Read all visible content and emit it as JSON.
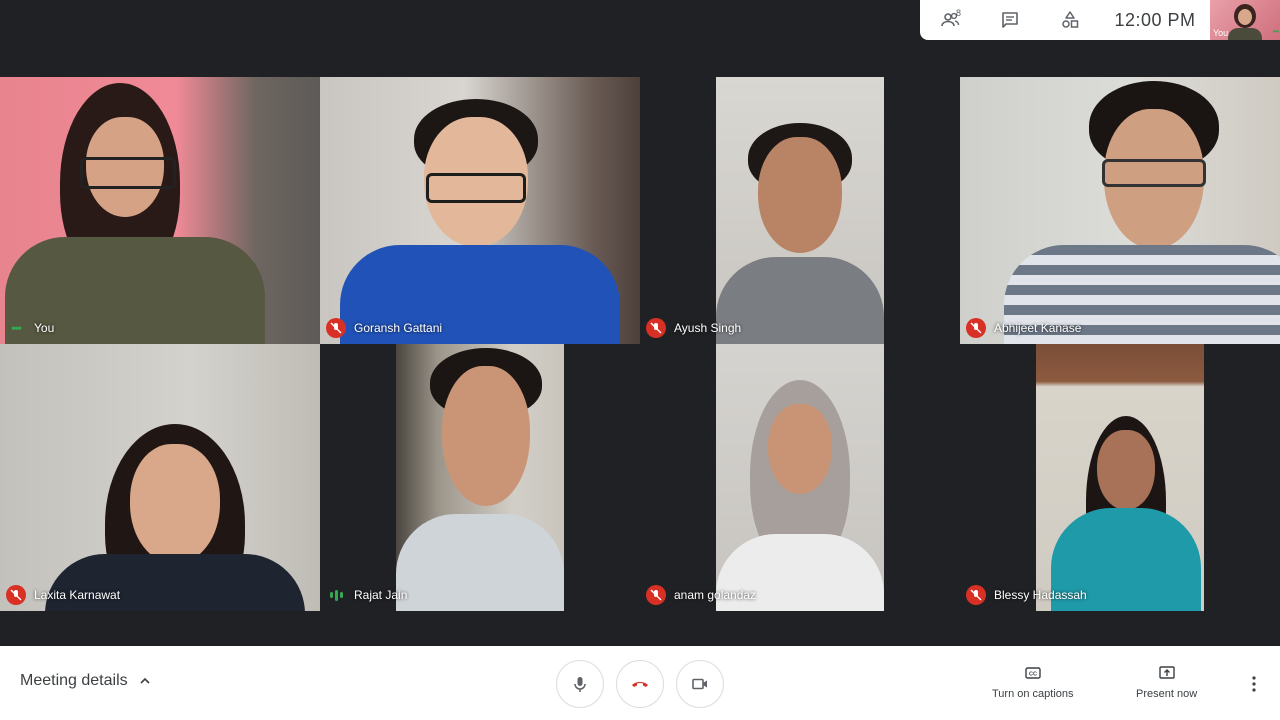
{
  "topbar": {
    "people_icon": "people-icon",
    "people_count": "8",
    "chat_icon": "chat-icon",
    "activities_icon": "activities-icon",
    "time": "12:00 PM",
    "self_label": "You"
  },
  "participants": [
    {
      "name": "You",
      "indicator": "speaking-dots"
    },
    {
      "name": "Goransh Gattani",
      "indicator": "muted"
    },
    {
      "name": "Ayush Singh",
      "indicator": "muted"
    },
    {
      "name": "Abhijeet Kanase",
      "indicator": "muted"
    },
    {
      "name": "Laxita Karnawat",
      "indicator": "muted"
    },
    {
      "name": "Rajat Jain",
      "indicator": "speaking-bars"
    },
    {
      "name": "anam golandaz",
      "indicator": "muted"
    },
    {
      "name": "Blessy Hadassah",
      "indicator": "muted"
    }
  ],
  "bottombar": {
    "meeting_details": "Meeting details",
    "captions_label": "Turn on captions",
    "present_label": "Present now"
  },
  "colors": {
    "muted_red": "#d93025",
    "active_green": "#34a853",
    "stage_bg": "#202124",
    "end_call_red": "#d93025"
  }
}
